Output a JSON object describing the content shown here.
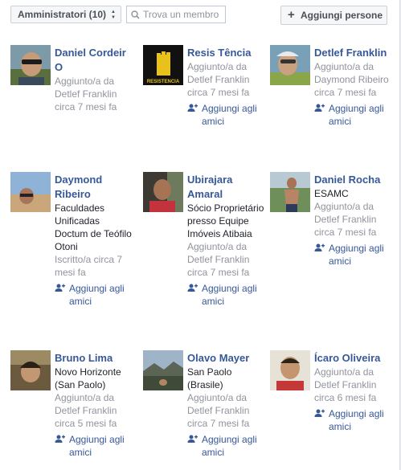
{
  "toolbar": {
    "filter_label": "Amministratori (10)",
    "search_placeholder": "Trova un membro",
    "add_label": "Aggiungi persone"
  },
  "members": [
    {
      "name": "Daniel Cordeir O",
      "details": [],
      "meta": "Aggiunto/a da Detlef Franklin circa 7 mesi fa",
      "add_friend": ""
    },
    {
      "name": "Resis Tência",
      "details": [],
      "meta": "Aggiunto/a da Detlef Franklin circa 7 mesi fa",
      "add_friend": "Aggiungi agli amici",
      "avatar_text": "RESISTENCIA"
    },
    {
      "name": "Detlef Franklin",
      "details": [],
      "meta": "Aggiunto/a da Daymond Ribeiro circa 7 mesi fa",
      "add_friend": "Aggiungi agli amici"
    },
    {
      "name": "Daymond Ribeiro",
      "details": [
        "Faculdades Unificadas Doctum de Teófilo Otoni"
      ],
      "meta": "Iscritto/a circa 7 mesi fa",
      "add_friend": "Aggiungi agli amici"
    },
    {
      "name": "Ubirajara Amaral",
      "details": [
        "Sócio Proprietário presso Equipe Imóveis Atibaia"
      ],
      "meta": "Aggiunto/a da Detlef Franklin circa 7 mesi fa",
      "add_friend": "Aggiungi agli amici"
    },
    {
      "name": "Daniel Rocha",
      "details": [
        "ESAMC"
      ],
      "meta": "Aggiunto/a da Detlef Franklin circa 7 mesi fa",
      "add_friend": "Aggiungi agli amici"
    },
    {
      "name": "Bruno Lima",
      "details": [
        "Novo Horizonte (San Paolo)"
      ],
      "meta": "Aggiunto/a da Detlef Franklin circa 5 mesi fa",
      "add_friend": "Aggiungi agli amici"
    },
    {
      "name": "Olavo Mayer",
      "details": [
        "San Paolo (Brasile)"
      ],
      "meta": "Aggiunto/a da Detlef Franklin circa 7 mesi fa",
      "add_friend": "Aggiungi agli amici"
    },
    {
      "name": "Ícaro Oliveira",
      "details": [],
      "meta": "Aggiunto/a da Detlef Franklin circa 6 mesi fa",
      "add_friend": "Aggiungi agli amici"
    }
  ],
  "colors": {
    "link": "#365899",
    "meta": "#90949c"
  },
  "icons": {
    "search": "search-icon",
    "add_person": "add-friend-icon",
    "filter_caret": "sort-caret-icon"
  }
}
